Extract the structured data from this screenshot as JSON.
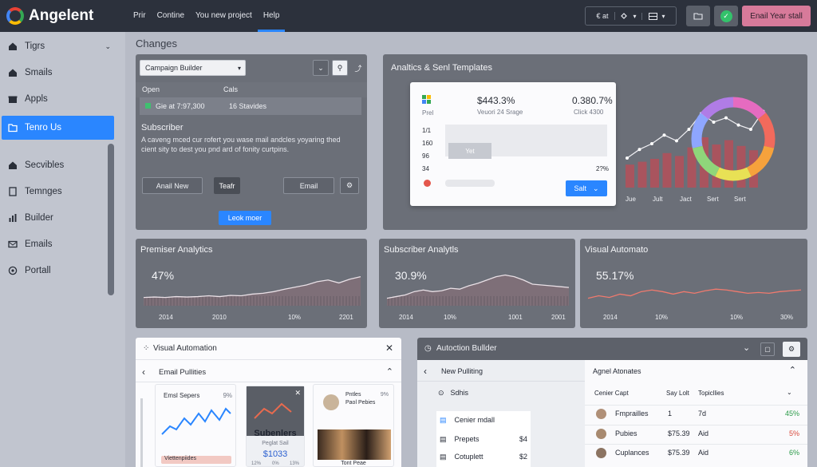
{
  "app": {
    "name": "Angelent"
  },
  "topnav": {
    "items": [
      "Prir",
      "Contine",
      "You new project",
      "Help"
    ]
  },
  "topbar": {
    "ctrl1": "€ at",
    "cta": "Enail Year stall"
  },
  "sidebar": {
    "items": [
      {
        "label": "Tigrs",
        "icon": "home-icon"
      },
      {
        "label": "Smails",
        "icon": "home-icon"
      },
      {
        "label": "Appls",
        "icon": "gift-icon"
      },
      {
        "label": "Tenro Us",
        "icon": "folder-icon"
      },
      {
        "label": "Secvibles",
        "icon": "home-icon"
      },
      {
        "label": "Temnges",
        "icon": "document-icon"
      },
      {
        "label": "Builder",
        "icon": "chart-icon"
      },
      {
        "label": "Emails",
        "icon": "mail-icon"
      },
      {
        "label": "Portall",
        "icon": "circle-icon"
      }
    ]
  },
  "main": {
    "section_title": "Changes"
  },
  "campaign": {
    "select_value": "Campaign Builder",
    "col1": "Open",
    "col2": "Cals",
    "row_val1": "Gie at 7:97,300",
    "row_val2": "16 Stavides",
    "subscriber_title": "Subscriber",
    "description": "A caveng mced cur rofert you wase mail andcles yoyaring thed cient sity to dest you pnd ard of fonity curtpins.",
    "btn1": "Anail New",
    "btn2": "Teafr",
    "btn3": "Email",
    "learn_more": "Leok moer"
  },
  "analytics": {
    "title": "Analtics & Senl Templates",
    "card": {
      "stat1_value": "$443.3%",
      "stat1_label": "Veuori 24 Srage",
      "stat2_value": "0.380.7%",
      "stat2_label": "Click 4300",
      "pret": "Prel",
      "y1": "1/1",
      "y2": "160",
      "y3": "96",
      "y4": "34",
      "pill": "Yet",
      "right_pct": "2?%",
      "button": "Salt"
    },
    "x_labels": [
      "Jue",
      "Jult",
      "Jact",
      "Sert",
      "Sert"
    ],
    "bar_values": [
      32,
      36,
      40,
      48,
      44,
      56,
      70,
      60,
      66,
      58,
      52
    ],
    "line_values": [
      30,
      42,
      50,
      62,
      54,
      70,
      92,
      80,
      86,
      76,
      70,
      95
    ],
    "donut_colors": [
      "#e66bc0",
      "#f26a5c",
      "#f6a23c",
      "#e8e155",
      "#8fd67a",
      "#8ea6ff",
      "#b07ce6"
    ]
  },
  "mini_charts": [
    {
      "title": "Premiser Analytics",
      "value": "47%",
      "labels": [
        "2014",
        "2010",
        "10%",
        "2201"
      ],
      "points": [
        20,
        21,
        20,
        22,
        21,
        22,
        24,
        22,
        25,
        24,
        28,
        30,
        34,
        40,
        45,
        50,
        58,
        62,
        55,
        64,
        70
      ],
      "fill": true
    },
    {
      "title": "Subscriber Analytls",
      "value": "30.9%",
      "labels": [
        "2014",
        "10%",
        "1001",
        "2001"
      ],
      "points": [
        18,
        22,
        26,
        34,
        38,
        34,
        36,
        42,
        40,
        48,
        54,
        62,
        70,
        74,
        70,
        62,
        52,
        50,
        48,
        46,
        44
      ],
      "fill": true
    },
    {
      "title": "Visual Automato",
      "value": "55.17%",
      "labels": [
        "2014",
        "10%",
        "10%",
        "30%"
      ],
      "points": [
        18,
        24,
        20,
        28,
        24,
        34,
        38,
        34,
        28,
        34,
        30,
        36,
        40,
        38,
        34,
        30,
        32,
        30,
        34,
        36,
        38
      ],
      "fill": false
    }
  ],
  "visual_automation": {
    "title": "Visual Automation",
    "section": "Email Pullities",
    "card1": {
      "title": "Emsl Sepers",
      "pct": "9%",
      "footer": "Viettenpiides"
    },
    "card2": {
      "title": "Subenlers",
      "sub": "Peglat Sail",
      "value": "$1033",
      "ticks": [
        "12%",
        "0%",
        "13%"
      ]
    },
    "card3": {
      "title": "Pntles",
      "sub": "Paol Pebies",
      "pct": "9%",
      "footer": "Tont Peae"
    }
  },
  "automation_builder": {
    "title": "Autoction Bullder",
    "left": {
      "header": "New Pulliting",
      "item0": "Sdhis",
      "item1": "Cenier mdall",
      "item2": "Prepets",
      "item2_val": "$4",
      "item3": "Cotuplett",
      "item3_val": "$2"
    },
    "right": {
      "header": "Agnel Atonates",
      "cols": [
        "Cenier Capt",
        "Say Lolt",
        "Topicllies"
      ],
      "rows": [
        {
          "name": "Fmprailles",
          "a": "1",
          "b": "7d",
          "pct": "45%"
        },
        {
          "name": "Pubies",
          "a": "$75.39",
          "b": "Aid",
          "pct": "5%"
        },
        {
          "name": "Cuplances",
          "a": "$75.39",
          "b": "Aid",
          "pct": "6%"
        }
      ]
    }
  }
}
